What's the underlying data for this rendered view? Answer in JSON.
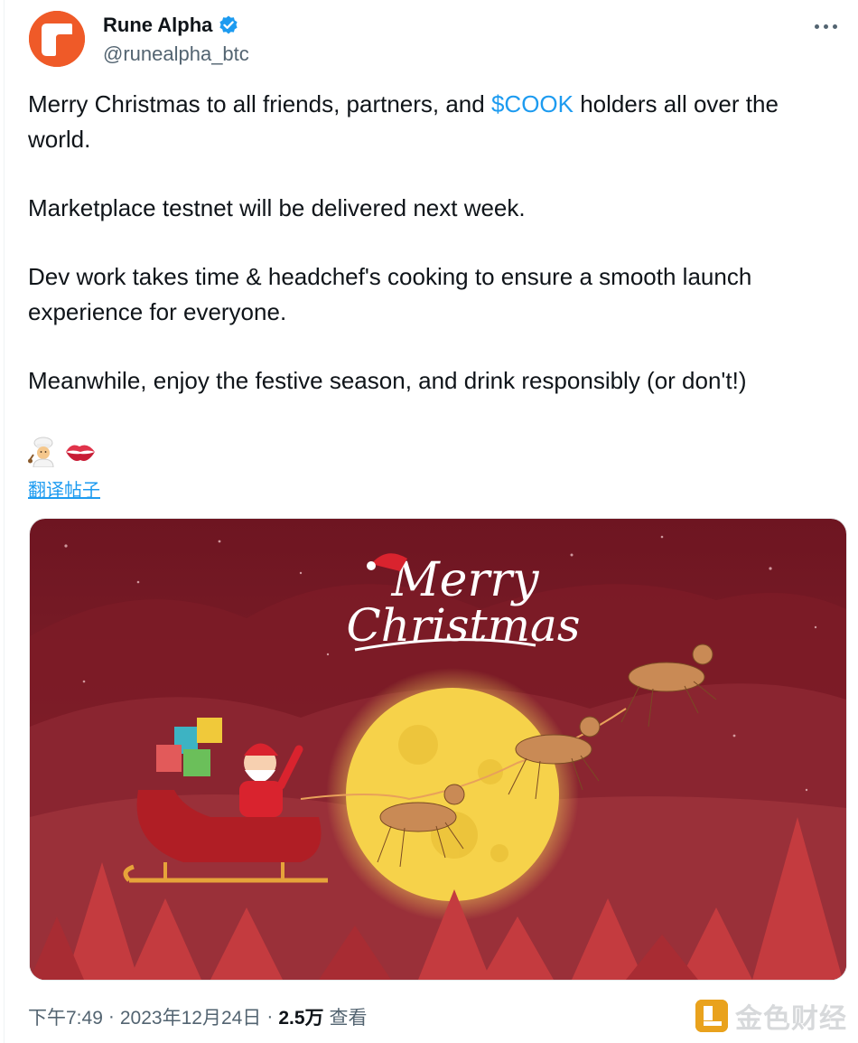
{
  "author": {
    "display_name": "Rune Alpha",
    "handle": "@runealpha_btc",
    "verified": true,
    "avatar_color": "#ef5a28"
  },
  "tweet": {
    "para1_before": "Merry Christmas to all friends, partners, and ",
    "para1_cashtag": "$COOK",
    "para1_after": " holders all over the world.",
    "para2": "Marketplace testnet will be delivered next week.",
    "para3": "Dev work takes time & headchef's cooking  to ensure a smooth launch experience for everyone.",
    "para4": "Meanwhile, enjoy the festive season, and drink responsibly (or don't!)",
    "emojis": [
      "👨‍🍳",
      "💋"
    ],
    "translate_label": "翻译帖子"
  },
  "media": {
    "caption_line1": "Merry",
    "caption_line2": "Christmas",
    "background_color": "#7a1a24",
    "moon_color": "#f6d24a"
  },
  "meta": {
    "time": "下午7:49",
    "date": "2023年12月24日",
    "separator": "·",
    "views_count": "2.5万",
    "views_label": "查看"
  },
  "watermark": {
    "text": "金色财经",
    "logo_color": "#e9a21d"
  },
  "colors": {
    "link": "#1d9bf0",
    "secondary_text": "#536471",
    "primary_text": "#0f1419"
  }
}
